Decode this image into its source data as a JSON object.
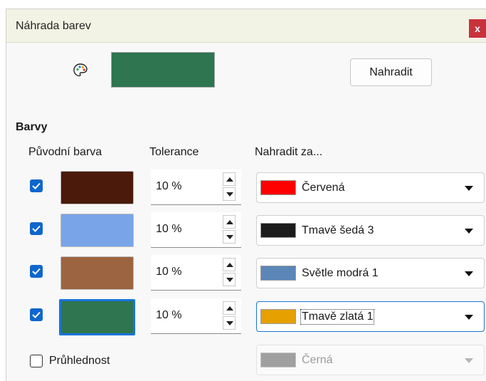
{
  "dialog": {
    "title": "Náhrada barev",
    "close_label": "x"
  },
  "source_preview": {
    "color": "#2e7550"
  },
  "replace_button": {
    "label": "Nahradit"
  },
  "colors_section": {
    "title": "Barvy",
    "headers": {
      "source": "Původní barva",
      "tolerance": "Tolerance",
      "replace_with": "Nahradit za..."
    },
    "rows": [
      {
        "checked": true,
        "source_color": "#4b1a0a",
        "tolerance": "10 %",
        "replace_label": "Červená",
        "replace_color": "#ff0000"
      },
      {
        "checked": true,
        "source_color": "#7aa4e8",
        "tolerance": "10 %",
        "replace_label": "Tmavě šedá 3",
        "replace_color": "#1c1c1c"
      },
      {
        "checked": true,
        "source_color": "#9c6440",
        "tolerance": "10 %",
        "replace_label": "Světle modrá 1",
        "replace_color": "#5a86b8"
      },
      {
        "checked": true,
        "source_color": "#2e7550",
        "tolerance": "10 %",
        "replace_label": "Tmavě zlatá 1",
        "replace_color": "#e6a000"
      }
    ]
  },
  "transparency": {
    "checked": false,
    "label": "Průhlednost",
    "replace_label": "Černá",
    "replace_color": "#a0a0a0"
  },
  "icons": {
    "palette": "palette-icon",
    "dropdown": "chevron-down-icon",
    "spin_up": "arrow-up-icon",
    "spin_down": "arrow-down-icon"
  }
}
